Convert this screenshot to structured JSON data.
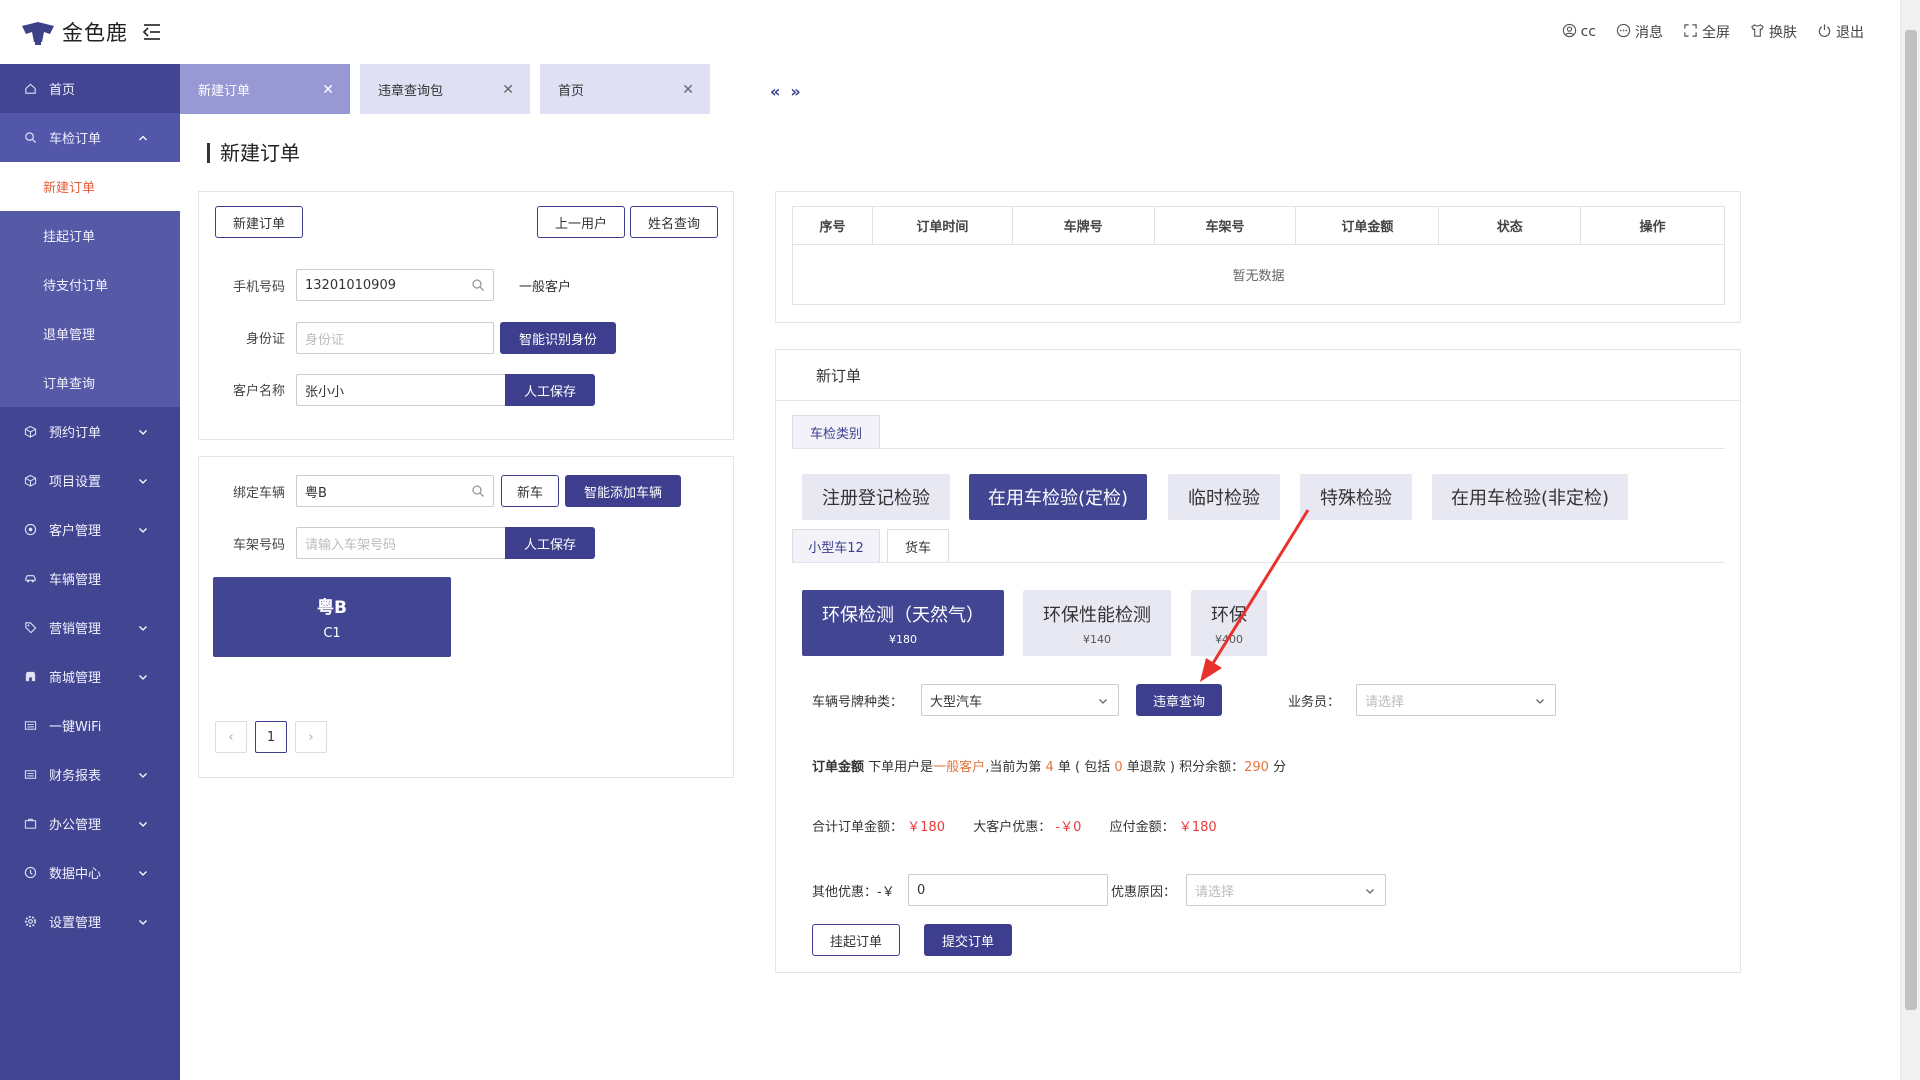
{
  "app": {
    "brand": "金色鹿"
  },
  "header": {
    "user": "cc",
    "messages": "消息",
    "fullscreen": "全屏",
    "skin": "换肤",
    "logout": "退出"
  },
  "sidebar": {
    "items": [
      {
        "label": "首页",
        "icon": "home-icon"
      },
      {
        "label": "车检订单",
        "icon": "search-icon",
        "open": true,
        "children": [
          "新建订单",
          "挂起订单",
          "待支付订单",
          "退单管理",
          "订单查询"
        ]
      },
      {
        "label": "预约订单",
        "icon": "cube-icon"
      },
      {
        "label": "项目设置",
        "icon": "cube-icon"
      },
      {
        "label": "客户管理",
        "icon": "target-icon"
      },
      {
        "label": "车辆管理",
        "icon": "car-icon"
      },
      {
        "label": "营销管理",
        "icon": "tag-icon"
      },
      {
        "label": "商城管理",
        "icon": "shop-icon"
      },
      {
        "label": "一键WiFi",
        "icon": "list-icon"
      },
      {
        "label": "财务报表",
        "icon": "list-icon"
      },
      {
        "label": "办公管理",
        "icon": "briefcase-icon"
      },
      {
        "label": "数据中心",
        "icon": "clock-icon"
      },
      {
        "label": "设置管理",
        "icon": "gear-icon"
      }
    ]
  },
  "tabs": [
    {
      "label": "新建订单",
      "active": true
    },
    {
      "label": "违章查询包",
      "active": false
    },
    {
      "label": "首页",
      "active": false
    }
  ],
  "page": {
    "title": "新建订单"
  },
  "customer": {
    "btn_new_order": "新建订单",
    "btn_prev_user": "上一用户",
    "btn_name_query": "姓名查询",
    "phone_label": "手机号码",
    "phone_value": "13201010909",
    "customer_type": "一般客户",
    "id_label": "身份证",
    "id_placeholder": "身份证",
    "btn_smart_id": "智能识别身份",
    "name_label": "客户名称",
    "name_value": "张小小",
    "btn_manual_save": "人工保存"
  },
  "vehicle": {
    "bind_label": "绑定车辆",
    "bind_value": "粤B",
    "btn_new_car": "新车",
    "btn_smart_add": "智能添加车辆",
    "vin_label": "车架号码",
    "vin_placeholder": "请输入车架号码",
    "btn_manual_save": "人工保存",
    "plate_main": "粤B",
    "plate_sub": "C1",
    "pager": {
      "prev": "‹",
      "current": "1",
      "next": "›"
    }
  },
  "orders_table": {
    "headers": [
      "序号",
      "订单时间",
      "车牌号",
      "车架号",
      "订单金额",
      "状态",
      "操作"
    ],
    "empty_text": "暂无数据"
  },
  "new_order": {
    "title": "新订单",
    "category_tab": "车检类别",
    "categories": [
      {
        "label": "注册登记检验",
        "active": false
      },
      {
        "label": "在用车检验(定检)",
        "active": true
      },
      {
        "label": "临时检验",
        "active": false
      },
      {
        "label": "特殊检验",
        "active": false
      },
      {
        "label": "在用车检验(非定检)",
        "active": false
      }
    ],
    "vehicle_tabs": [
      "小型车12",
      "货车"
    ],
    "services": [
      {
        "name": "环保检测（天然气）",
        "price": "¥180",
        "active": true
      },
      {
        "name": "环保性能检测",
        "price": "¥140",
        "active": false
      },
      {
        "name": "环保",
        "price": "¥400",
        "active": false
      }
    ],
    "plate_type_label": "车辆号牌种类：",
    "plate_type_value": "大型汽车",
    "btn_violation": "违章查询",
    "staff_label": "业务员：",
    "staff_placeholder": "请选择",
    "summary": {
      "title": "订单金额",
      "t1": "下单用户是",
      "user_type": "一般客户",
      "t2": ",当前为第",
      "count": "4",
      "t3": "单 ( 包括",
      "refunds": "0",
      "t4": "单退款 ) 积分余额：",
      "points": "290",
      "t5": "分"
    },
    "totals": {
      "total_label": "合计订单金额：",
      "total_value": "￥180",
      "discount_label": "大客户优惠：",
      "discount_value": "-￥0",
      "pay_label": "应付金额：",
      "pay_value": "￥180"
    },
    "other_discount_label": "其他优惠：-￥",
    "other_discount_value": "0",
    "reason_label": "优惠原因：",
    "reason_placeholder": "请选择",
    "btn_hold": "挂起订单",
    "btn_submit": "提交订单"
  },
  "colors": {
    "primary": "#424592",
    "accent": "#e35e3d",
    "price": "#e83b3b"
  }
}
